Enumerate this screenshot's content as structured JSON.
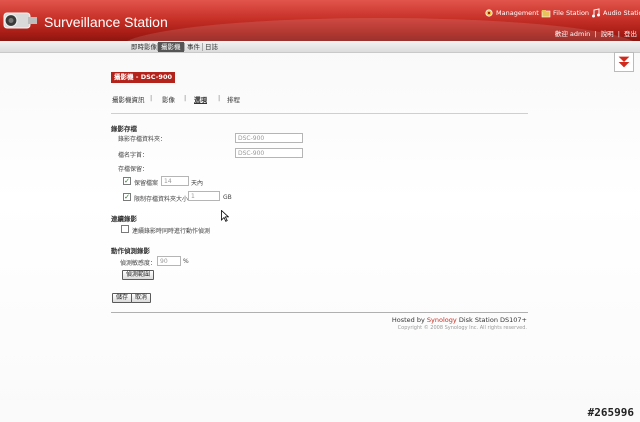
{
  "header": {
    "app_title": "Surveillance Station",
    "links": [
      {
        "label": "Management",
        "icon": "management-icon"
      },
      {
        "label": "File Station",
        "icon": "file-station-icon"
      },
      {
        "label": "Audio Station",
        "icon": "audio-station-icon"
      }
    ],
    "user_line": [
      "歡迎 admin",
      "說明",
      "登出"
    ],
    "user_separator": "|"
  },
  "tabs": [
    {
      "label": "即時影像",
      "active": false
    },
    {
      "label": "攝影機",
      "active": true
    },
    {
      "label": "事件",
      "active": false
    },
    {
      "label": "日誌",
      "active": false
    }
  ],
  "page": {
    "camera_title": "攝影機 - DSC-900",
    "subnav": [
      "攝影機資訊",
      "影像",
      "選項",
      "排程"
    ],
    "subnav_active": "選項",
    "subnav_separator": "|"
  },
  "recording_storage": {
    "title": "錄影存檔",
    "folder_label": "錄影存檔資料夾：",
    "folder_value": "DSC-900",
    "prefix_label": "檔名字首：",
    "prefix_value": "DSC-900",
    "storage_label": "存檔保留：",
    "keep_files": {
      "label": "保留檔案",
      "value": "14",
      "unit": "天內",
      "checked": true
    },
    "limit_size": {
      "label": "限制存檔資料夾大小",
      "value": "1",
      "unit": "GB",
      "checked": true
    }
  },
  "continuous_recording": {
    "title": "連續錄影",
    "option_label": "連續錄影時同時進行動作偵測",
    "checked": false
  },
  "motion_detection": {
    "title": "動作偵測錄影",
    "sensitivity_label": "偵測敏感度：",
    "sensitivity_value": "90",
    "sensitivity_unit": "%",
    "area_button": "偵測範圍"
  },
  "actions": {
    "save": "儲存",
    "cancel": "取消"
  },
  "footer": {
    "hosted_prefix": "Hosted by",
    "brand": "Synology",
    "product": "Disk Station DS107+",
    "copyright": "Copyright © 2008 Synology Inc. All rights reserved."
  },
  "watermark": "#265996",
  "colors": {
    "header_red": "#c73128",
    "badge_red": "#b3231b",
    "brand_red": "#c7291e",
    "check_green": "#1c7d1c"
  }
}
